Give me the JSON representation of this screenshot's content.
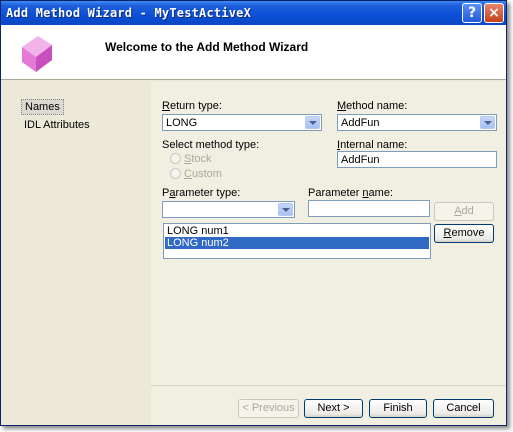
{
  "window": {
    "title": "Add Method Wizard - MyTestActiveX",
    "help_label": "?",
    "close_label": "×"
  },
  "header": {
    "heading": "Welcome to the Add Method Wizard",
    "logo_icon": "pink-cube-icon"
  },
  "sidebar": {
    "items": [
      {
        "label": "Names",
        "selected": true
      },
      {
        "label": "IDL Attributes",
        "selected": false
      }
    ]
  },
  "form": {
    "return_type": {
      "label_underline": "R",
      "label_rest": "eturn type:",
      "value": "LONG"
    },
    "method_name": {
      "label_underline": "M",
      "label_rest": "ethod name:",
      "value": "AddFun"
    },
    "method_type": {
      "label": "Select method type:",
      "options": [
        {
          "label_underline": "S",
          "label_rest": "tock"
        },
        {
          "label_underline": "C",
          "label_rest": "ustom"
        }
      ]
    },
    "internal_name": {
      "label_underline": "I",
      "label_rest": "nternal name:",
      "value": "AddFun"
    },
    "parameter_type": {
      "label_prefix": "P",
      "label_underline": "a",
      "label_rest": "rameter type:",
      "value": ""
    },
    "parameter_name": {
      "label_prefix": "Parameter ",
      "label_underline": "n",
      "label_rest": "ame:",
      "value": ""
    },
    "add_button": {
      "label_underline": "A",
      "label_rest": "dd"
    },
    "remove_button": {
      "label_underline": "R",
      "label_rest": "emove"
    },
    "parameters": [
      {
        "text": "LONG num1",
        "selected": false
      },
      {
        "text": "LONG num2",
        "selected": true
      }
    ]
  },
  "footer": {
    "previous": "< Previous",
    "next": "Next >",
    "finish": "Finish",
    "cancel": "Cancel"
  },
  "colors": {
    "title_bar": "#0b4fd6",
    "selection": "#316ac5",
    "logo": "#e27ad6"
  }
}
